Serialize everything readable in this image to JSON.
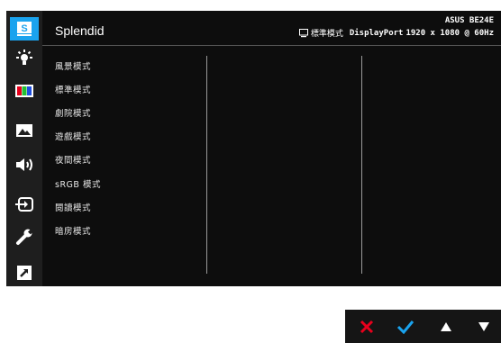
{
  "header": {
    "title": "Splendid",
    "model": "ASUS BE24E",
    "current_mode": "標準模式",
    "input": "DisplayPort",
    "resolution": "1920 x 1080 @ 60Hz"
  },
  "sidebar": {
    "items": [
      {
        "icon": "splendid-icon",
        "label": "S",
        "active": true
      },
      {
        "icon": "blue-light-icon"
      },
      {
        "icon": "color-icon"
      },
      {
        "icon": "image-icon"
      },
      {
        "icon": "sound-icon"
      },
      {
        "icon": "input-select-icon"
      },
      {
        "icon": "system-setup-icon"
      },
      {
        "icon": "shortcut-icon"
      }
    ]
  },
  "menu": {
    "items": [
      {
        "label": "風景模式"
      },
      {
        "label": "標準模式"
      },
      {
        "label": "劇院模式"
      },
      {
        "label": "遊戲模式"
      },
      {
        "label": "夜間模式"
      },
      {
        "label": "sRGB 模式"
      },
      {
        "label": "閱讀模式"
      },
      {
        "label": "暗房模式"
      }
    ]
  },
  "buttons": {
    "items": [
      {
        "icon": "close-icon",
        "color": "#e8001c"
      },
      {
        "icon": "check-icon",
        "color": "#1aa3ee"
      },
      {
        "icon": "up-arrow-icon",
        "color": "#ffffff"
      },
      {
        "icon": "down-arrow-icon",
        "color": "#ffffff"
      }
    ]
  },
  "colors": {
    "accent": "#1aa3ee",
    "background": "#0d0d0d"
  }
}
